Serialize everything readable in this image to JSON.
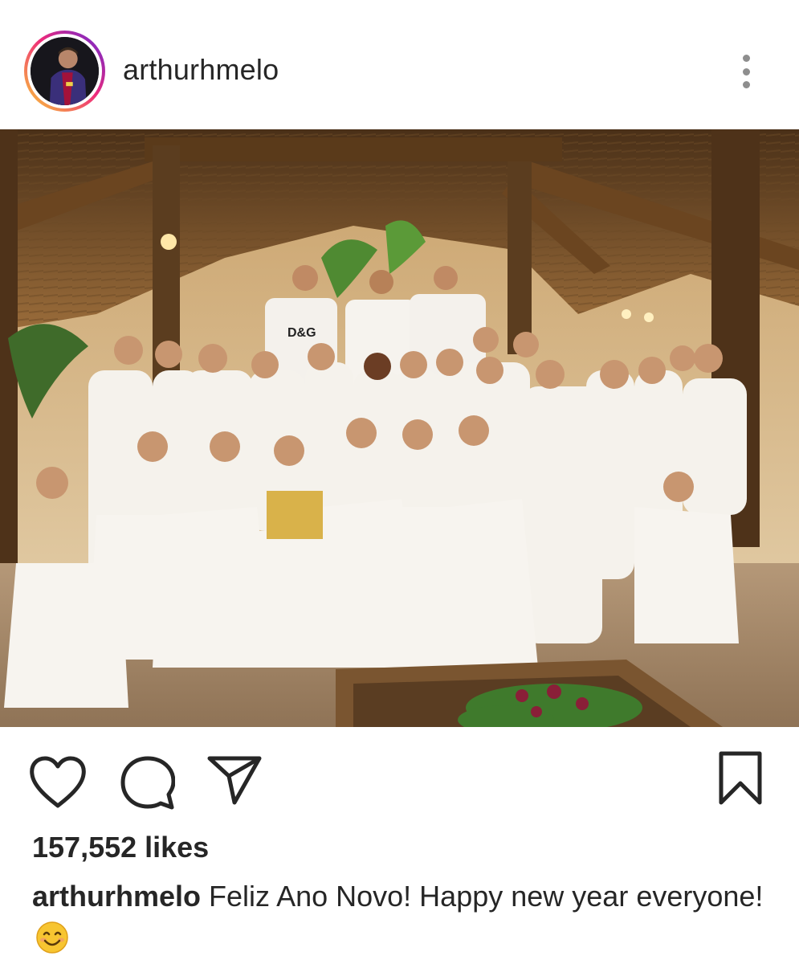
{
  "header": {
    "username": "arthurhmelo"
  },
  "icons": {
    "avatar": "profile-photo",
    "more": "more-vertical-icon",
    "like": "heart-icon",
    "comment": "comment-icon",
    "share": "paper-plane-icon",
    "save": "bookmark-icon",
    "emoji": "smiling-face-emoji"
  },
  "post": {
    "image_alt": "Group photo of people dressed in white under a thatched roof pavilion"
  },
  "stats": {
    "likes": "157,552 likes"
  },
  "caption": {
    "username": "arthurhmelo",
    "text": "Feliz Ano Novo! Happy new year everyone!"
  },
  "colors": {
    "text": "#262626",
    "muted": "#8e8e8e",
    "story_ring_start": "#f9ce34",
    "story_ring_end": "#6228d7"
  }
}
